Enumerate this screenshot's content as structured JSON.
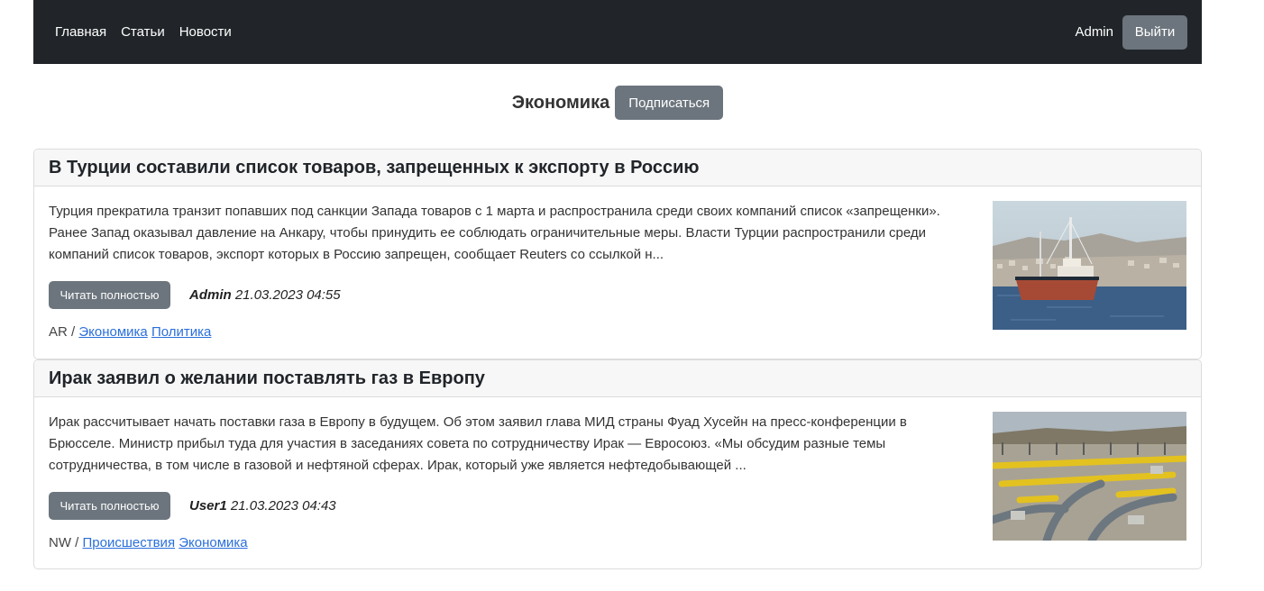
{
  "nav": {
    "links": [
      "Главная",
      "Статьи",
      "Новости"
    ],
    "user": "Admin",
    "logout_label": "Выйти"
  },
  "category": {
    "title": "Экономика",
    "subscribe_label": "Подписаться"
  },
  "articles": [
    {
      "title": "В Турции составили список товаров, запрещенных к экспорту в Россию",
      "text": "Турция прекратила транзит попавших под санкции Запада товаров с 1 марта и распространила среди своих компаний список «запрещенки». Ранее Запад оказывал давление на Анкару, чтобы принудить ее соблюдать ограничительные меры. Власти Турции распространили среди компаний список товаров, экспорт которых в Россию запрещен, сообщает Reuters со ссылкой н...",
      "read_label": "Читать полностью",
      "author": "Admin",
      "date": "21.03.2023 04:55",
      "source": "AR /",
      "tags": [
        "Экономика",
        "Политика"
      ],
      "image": "ship-photo"
    },
    {
      "title": "Ирак заявил о желании поставлять газ в Европу",
      "text": "Ирак рассчитывает начать поставки газа в Европу в будущем. Об этом заявил глава МИД страны Фуад Хусейн на пресс-конференции в Брюсселе. Министр прибыл туда для участия в заседаниях совета по сотрудничеству Ирак — Евросоюз. «Мы обсудим разные темы сотрудничества, в том числе в газовой и нефтяной сферах. Ирак, который уже является нефтедобывающей ...",
      "read_label": "Читать полностью",
      "author": "User1",
      "date": "21.03.2023 04:43",
      "source": "NW /",
      "tags": [
        "Происшествия",
        "Экономика"
      ],
      "image": "gas-pipeline-photo"
    }
  ]
}
